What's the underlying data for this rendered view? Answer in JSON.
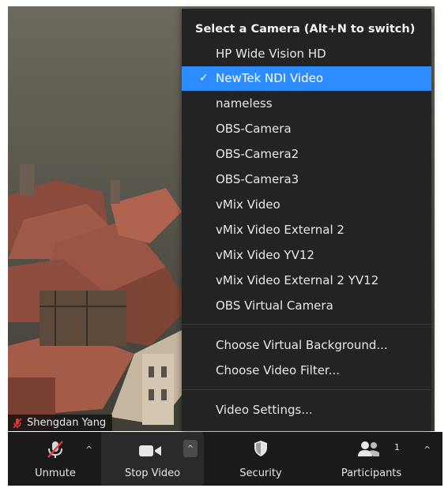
{
  "video": {
    "participant_name": "Shengdan Yang"
  },
  "camera_menu": {
    "header": "Select a Camera (Alt+N to switch)",
    "cameras": [
      {
        "label": "HP Wide Vision HD",
        "selected": false
      },
      {
        "label": "NewTek NDI Video",
        "selected": true
      },
      {
        "label": "nameless",
        "selected": false
      },
      {
        "label": "OBS-Camera",
        "selected": false
      },
      {
        "label": "OBS-Camera2",
        "selected": false
      },
      {
        "label": "OBS-Camera3",
        "selected": false
      },
      {
        "label": "vMix Video",
        "selected": false
      },
      {
        "label": "vMix Video External 2",
        "selected": false
      },
      {
        "label": "vMix Video YV12",
        "selected": false
      },
      {
        "label": "vMix Video External 2 YV12",
        "selected": false
      },
      {
        "label": "OBS Virtual Camera",
        "selected": false
      }
    ],
    "check_glyph": "✓",
    "actions": [
      {
        "label": "Choose Virtual Background..."
      },
      {
        "label": "Choose Video Filter..."
      }
    ],
    "settings": {
      "label": "Video Settings..."
    },
    "selected_color": "#2d8cff"
  },
  "toolbar": {
    "unmute_label": "Unmute",
    "stop_video_label": "Stop Video",
    "security_label": "Security",
    "participants_label": "Participants",
    "participants_count": "1",
    "caret_glyph": "^"
  }
}
